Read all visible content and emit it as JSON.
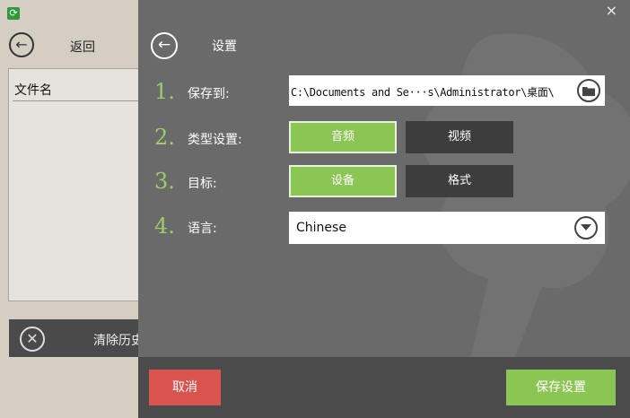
{
  "background_window": {
    "back_label": "返回",
    "file_column_header": "文件名",
    "clear_history_label": "清除历史"
  },
  "dialog": {
    "title": "设置",
    "close_glyph": "×",
    "rows": [
      {
        "number": "1.",
        "label": "保存到:"
      },
      {
        "number": "2.",
        "label": "类型设置:"
      },
      {
        "number": "3.",
        "label": "目标:"
      },
      {
        "number": "4.",
        "label": "语言:"
      }
    ],
    "save_path": "C:\\Documents and Se···s\\Administrator\\桌面\\",
    "type_options": [
      {
        "label": "音频",
        "selected": true
      },
      {
        "label": "视频",
        "selected": false
      }
    ],
    "target_options": [
      {
        "label": "设备",
        "selected": true
      },
      {
        "label": "格式",
        "selected": false
      }
    ],
    "language_selected": "Chinese",
    "cancel_label": "取消",
    "save_label": "保存设置"
  },
  "icons": {
    "back": "arrow-left-circle-icon",
    "folder": "folder-icon",
    "dropdown": "chevron-down-circle-icon",
    "clear": "close-circle-icon",
    "app": "refresh-icon"
  },
  "colors": {
    "accent_green": "#8bc655",
    "number_green": "#9ccd6b",
    "cancel_red": "#d9534f",
    "dialog_bg": "#6a6a6a",
    "dark_button": "#3d3d3d"
  }
}
